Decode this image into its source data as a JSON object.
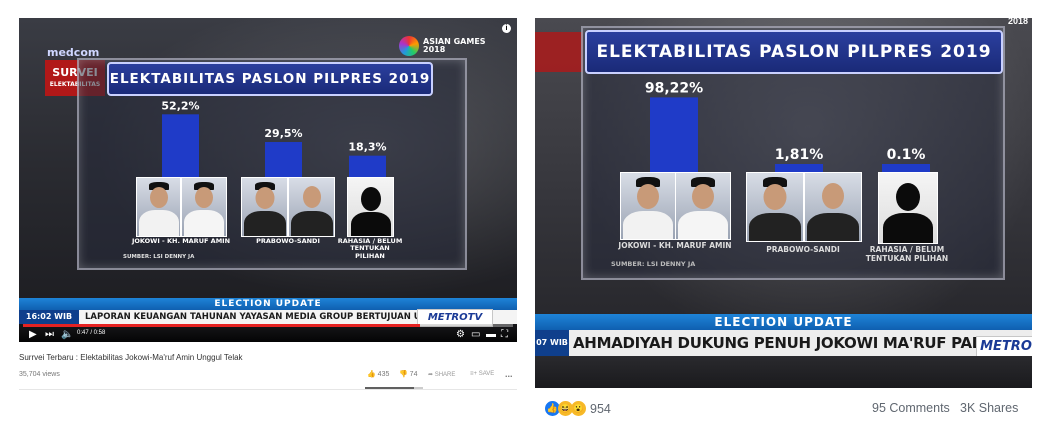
{
  "left_video": {
    "survei_line1": "SURVEI",
    "survei_line2": "ELEKTABILITAS",
    "medcom": "medcom",
    "asian_games_line1": "ASIAN GAMES",
    "asian_games_line2": "2018",
    "chart_title": "ELEKTABILITAS PASLON PILPRES 2019",
    "source": "SUMBER: LSI DENNY JA",
    "election_update": "ELECTION UPDATE",
    "time": "16:02 WIB",
    "ticker": "LAPORAN KEUANGAN TAHUNAN YAYASAN MEDIA GROUP BERTUJUAN UN",
    "channel": "METROTV",
    "player_time": "0:47 / 0:58",
    "progress": 0.81,
    "info_icon": "info-icon"
  },
  "left_meta": {
    "title": "Surrvei Terbaru : Elektabilitas Jokowi-Ma'ruf Amin Unggul Telak",
    "views": "35,704 views",
    "likes": "435",
    "dislikes": "74",
    "share": "SHARE",
    "save": "SAVE",
    "more": "..."
  },
  "right_video": {
    "chart_title": "ELEKTABILITAS PASLON PILPRES 2019",
    "source": "SUMBER: LSI DENNY JA",
    "election_update": "ELECTION UPDATE",
    "time": "07 WIB",
    "ticker": "AHMADIYAH DUKUNG PENUH JOKOWI MA'RUF PADA PILPRES",
    "channel": "METRO",
    "top_right": "2018"
  },
  "right_meta": {
    "reactions_count": "954",
    "comments": "95 Comments",
    "shares": "3K Shares"
  },
  "chart_data": [
    {
      "type": "bar",
      "title": "ELEKTABILITAS PASLON PILPRES 2019",
      "categories": [
        "JOKOWI - KH. MARUF AMIN",
        "PRABOWO-SANDI",
        "RAHASIA / BELUM TENTUKAN PILIHAN"
      ],
      "values": [
        52.2,
        29.5,
        18.3
      ],
      "value_labels": [
        "52,2%",
        "29,5%",
        "18,3%"
      ],
      "colors": [
        "#1f3bc8"
      ]
    },
    {
      "type": "bar",
      "title": "ELEKTABILITAS PASLON PILPRES 2019",
      "categories": [
        "JOKOWI - KH. MARUF AMIN",
        "PRABOWO-SANDI",
        "RAHASIA / BELUM TENTUKAN PILIHAN"
      ],
      "values": [
        98.22,
        1.81,
        0.1
      ],
      "value_labels": [
        "98,22%",
        "1,81%",
        "0.1%"
      ],
      "colors": [
        "#1f3bc8"
      ]
    }
  ]
}
